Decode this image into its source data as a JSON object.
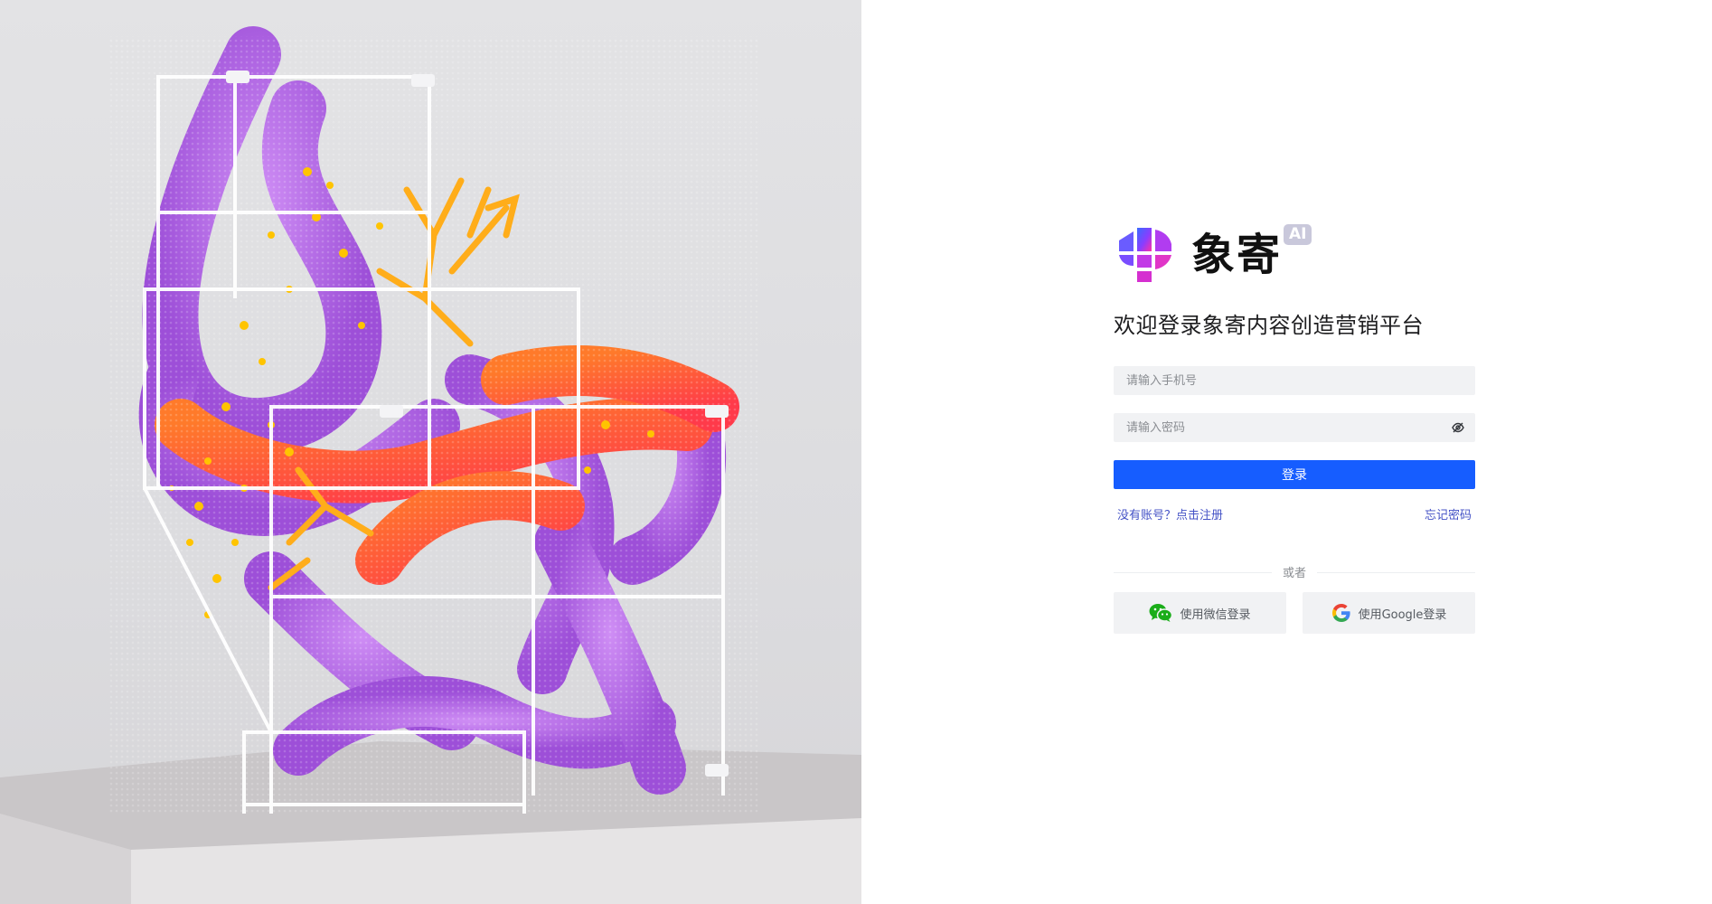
{
  "hero": {
    "image": "abstract-3d-sculpture",
    "colors": {
      "background": "#dedee0",
      "purple": "#b06be0",
      "red_orange": "#ff5a36",
      "yellow": "#ffb400",
      "frame": "#ffffff"
    }
  },
  "brand": {
    "logo": "xiangji-logo",
    "name": "象寄",
    "badge": "AI"
  },
  "welcome_title": "欢迎登录象寄内容创造营销平台",
  "form": {
    "phone_placeholder": "请输入手机号",
    "password_placeholder": "请输入密码",
    "password_toggle_icon": "eye-off-icon",
    "login_button": "登录"
  },
  "links": {
    "register": "没有账号？点击注册",
    "forgot_password": "忘记密码"
  },
  "divider_text": "或者",
  "social": {
    "wechat_label": "使用微信登录",
    "wechat_icon": "wechat-icon",
    "google_label": "使用Google登录",
    "google_icon": "google-icon"
  },
  "colors": {
    "primary": "#165dff",
    "link": "#4452c6",
    "input_bg": "#f1f2f4",
    "wechat_green": "#1aad19"
  }
}
